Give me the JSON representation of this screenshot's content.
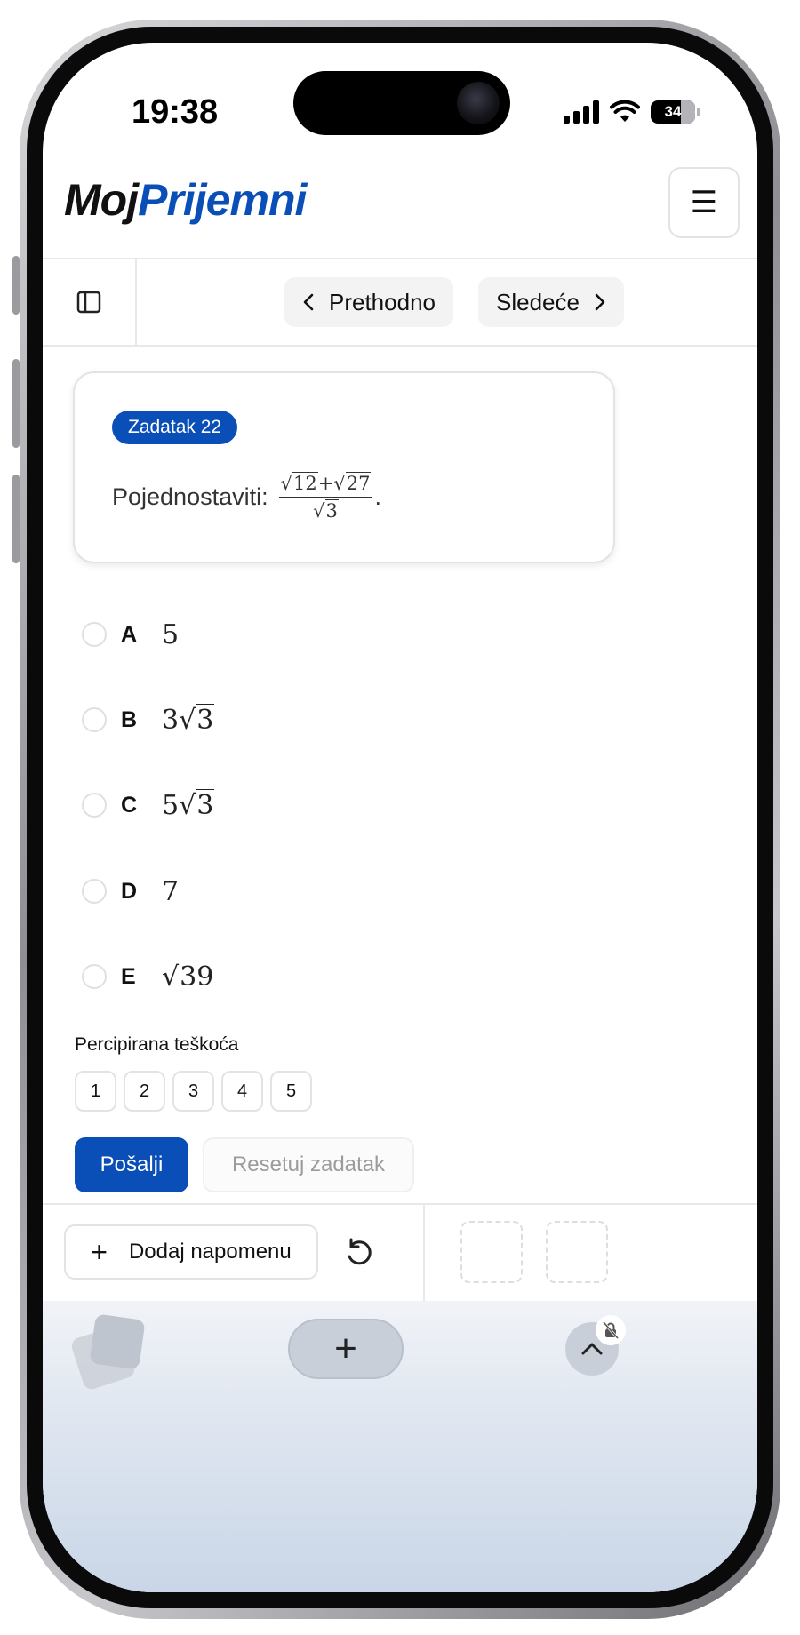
{
  "status_bar": {
    "time": "19:38",
    "battery": "34"
  },
  "header": {
    "logo_part1": "Moj",
    "logo_part2": "Prijemni",
    "menu_icon": "☰"
  },
  "nav": {
    "prev_label": "Prethodno",
    "next_label": "Sledeće"
  },
  "task": {
    "badge": "Zadatak 22",
    "prompt": "Pojednostaviti:",
    "fraction_numerator_a": "12",
    "fraction_plus": "+",
    "fraction_numerator_b": "27",
    "fraction_denominator": "3",
    "trailing": "."
  },
  "options": [
    {
      "letter": "A",
      "prefix": "5",
      "radicand": ""
    },
    {
      "letter": "B",
      "prefix": "3",
      "radicand": "3"
    },
    {
      "letter": "C",
      "prefix": "5",
      "radicand": "3"
    },
    {
      "letter": "D",
      "prefix": "7",
      "radicand": ""
    },
    {
      "letter": "E",
      "prefix": "",
      "radicand": "39"
    }
  ],
  "difficulty": {
    "label": "Percipirana teškoća",
    "levels": [
      "1",
      "2",
      "3",
      "4",
      "5"
    ]
  },
  "actions": {
    "submit_label": "Pošalji",
    "reset_label": "Resetuj zadatak"
  },
  "notes": {
    "add_label": "Dodaj napomenu",
    "plus_icon": "+"
  },
  "browser": {
    "new_tab_icon": "+"
  },
  "colors": {
    "brand_blue": "#0a4fb8",
    "logo_dark": "#111111"
  }
}
